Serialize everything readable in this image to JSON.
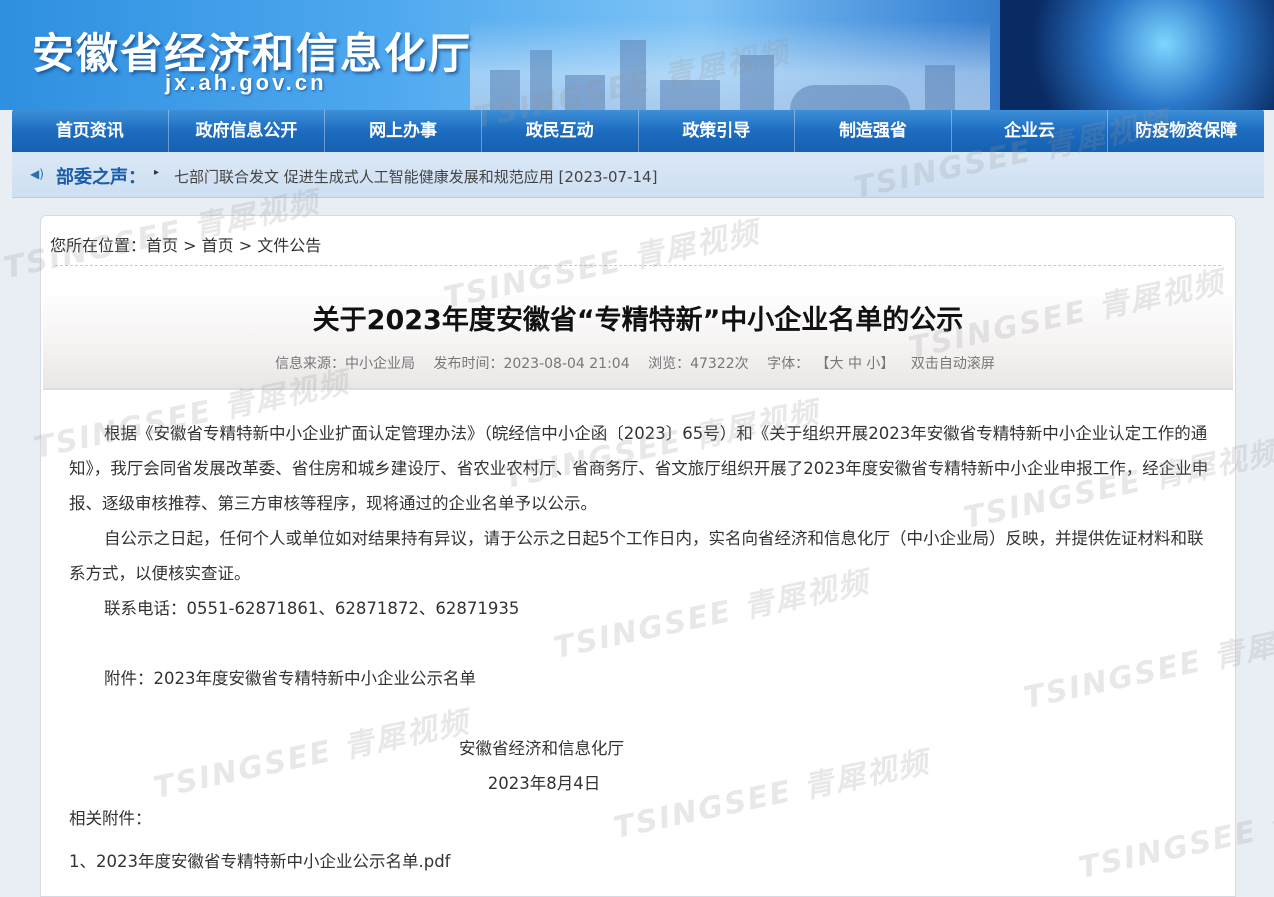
{
  "header": {
    "site_title": "安徽省经济和信息化厅",
    "site_domain": "jx.ah.gov.cn"
  },
  "nav": {
    "items": [
      "首页资讯",
      "政府信息公开",
      "网上办事",
      "政民互动",
      "政策引导",
      "制造强省",
      "企业云",
      "防疫物资保障"
    ]
  },
  "voice": {
    "label": "部委之声：",
    "link_text": "七部门联合发文 促进生成式人工智能健康发展和规范应用 [2023-07-14]"
  },
  "breadcrumb": {
    "prefix": "您所在位置：",
    "items": [
      "首页",
      "首页",
      "文件公告"
    ],
    "sep": ">"
  },
  "article": {
    "title": "关于2023年度安徽省“专精特新”中小企业名单的公示",
    "meta": {
      "source": "信息来源：中小企业局",
      "publish_time": "发布时间：2023-08-04 21:04",
      "views": "浏览：47322次",
      "font_label": "字体：",
      "font_sizes": "【大 中 小】",
      "autoscroll": "双击自动滚屏"
    },
    "para1": "根据《安徽省专精特新中小企业扩面认定管理办法》（皖经信中小企函〔2023〕65号）和《关于组织开展2023年安徽省专精特新中小企业认定工作的通知》，我厅会同省发展改革委、省住房和城乡建设厅、省农业农村厅、省商务厅、省文旅厅组织开展了2023年度安徽省专精特新中小企业申报工作，经企业申报、逐级审核推荐、第三方审核等程序，现将通过的企业名单予以公示。",
    "para2": "自公示之日起，任何个人或单位如对结果持有异议，请于公示之日起5个工作日内，实名向省经济和信息化厅（中小企业局）反映，并提供佐证材料和联系方式，以便核实查证。",
    "contact": "联系电话：0551-62871861、62871872、62871935",
    "attachment_line": "附件：2023年度安徽省专精特新中小企业公示名单",
    "signer": "安徽省经济和信息化厅",
    "date": "2023年8月4日",
    "related_label": "相关附件：",
    "related_file": "1、2023年度安徽省专精特新中小企业公示名单.pdf"
  },
  "watermark": "TSINGSEE 青犀视频"
}
